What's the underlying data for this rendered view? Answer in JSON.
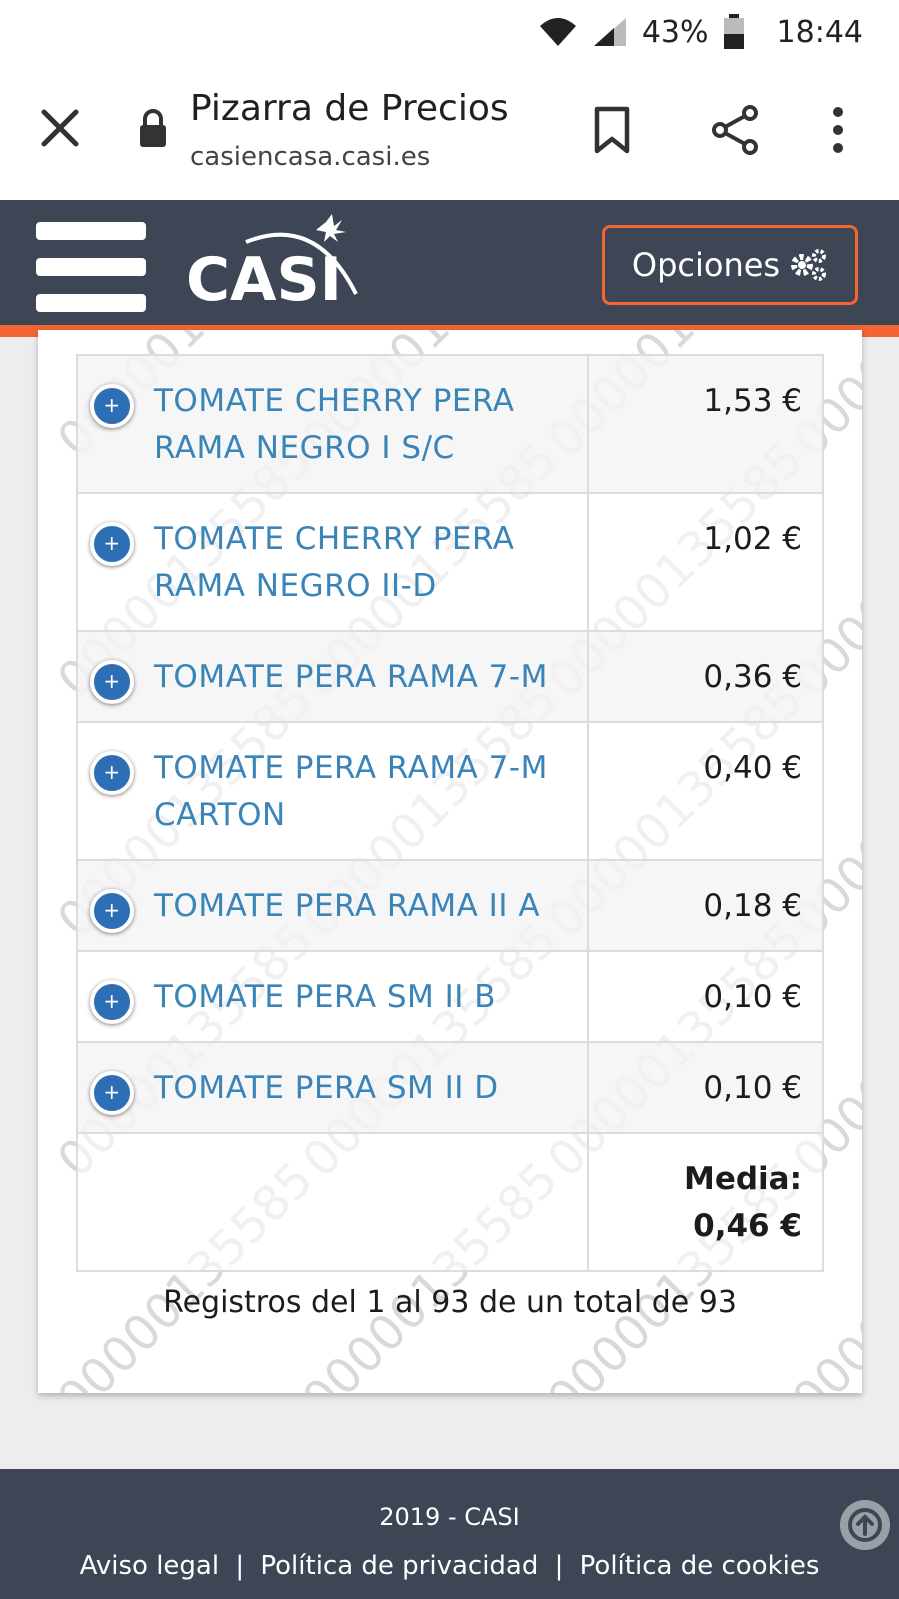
{
  "status_bar": {
    "battery": "43%",
    "time": "18:44"
  },
  "browser": {
    "title": "Pizarra de Precios",
    "url": "casiencasa.casi.es"
  },
  "header": {
    "logo_text": "CASI",
    "options_label": "Opciones"
  },
  "watermark": {
    "text": "00000135585"
  },
  "products": [
    {
      "name": "TOMATE CHERRY PERA RAMA NEGRO I S/C",
      "price": "1,53 €"
    },
    {
      "name": "TOMATE CHERRY PERA RAMA NEGRO II-D",
      "price": "1,02 €"
    },
    {
      "name": "TOMATE PERA RAMA 7-M",
      "price": "0,36 €"
    },
    {
      "name": "TOMATE PERA RAMA 7-M CARTON",
      "price": "0,40 €"
    },
    {
      "name": "TOMATE PERA RAMA II A",
      "price": "0,18 €"
    },
    {
      "name": "TOMATE PERA SM II B",
      "price": "0,10 €"
    },
    {
      "name": "TOMATE PERA SM II D",
      "price": "0,10 €"
    }
  ],
  "expand_symbol": "+",
  "media_label": "Media: 0,46 €",
  "records_text": "Registros del 1 al 93 de un total de 93",
  "footer": {
    "year": "2019 - CASI",
    "links": [
      "Aviso legal",
      "Política de privacidad",
      "Política de cookies"
    ],
    "separator": "|"
  }
}
